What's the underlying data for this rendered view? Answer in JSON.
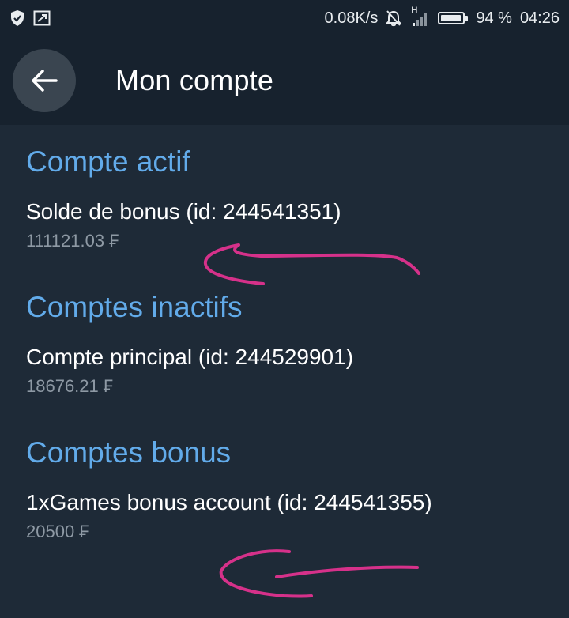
{
  "status_bar": {
    "network_speed": "0.08K/s",
    "network_type": "H",
    "battery_percent": "94 %",
    "battery_level": 0.94,
    "time": "04:26",
    "icons": [
      "shield-icon",
      "screen-cast-icon",
      "bell-off-icon",
      "signal-icon",
      "battery-icon"
    ]
  },
  "header": {
    "title": "Mon compte",
    "back_icon": "arrow-left-icon"
  },
  "sections": [
    {
      "heading": "Compte actif",
      "accounts": [
        {
          "name": "Solde de bonus (id: 244541351)",
          "balance": "111121.03 ₣"
        }
      ]
    },
    {
      "heading": "Comptes inactifs",
      "accounts": [
        {
          "name": "Compte principal (id: 244529901)",
          "balance": "18676.21 ₣"
        }
      ]
    },
    {
      "heading": "Comptes bonus",
      "accounts": [
        {
          "name": "1xGames bonus account (id: 244541355)",
          "balance": "20500 ₣"
        }
      ]
    }
  ],
  "colors": {
    "background": "#1e2a37",
    "header": "#17222e",
    "accent": "#62abea",
    "annotation": "#d6318a",
    "secondary_text": "#8e99a4"
  }
}
